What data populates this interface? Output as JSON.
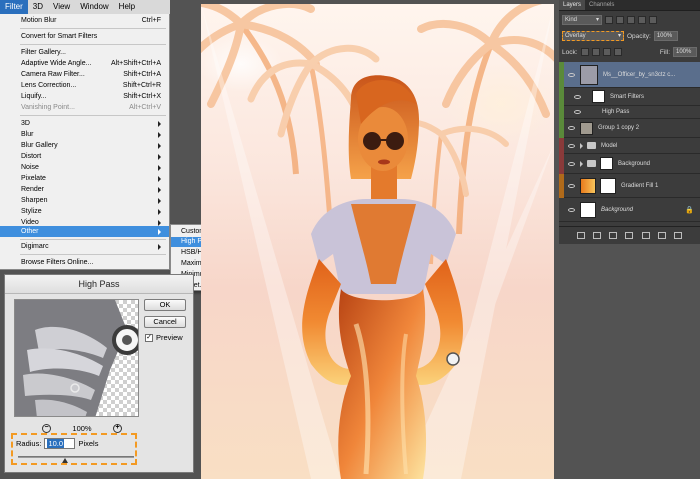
{
  "menubar": {
    "items": [
      "Filter",
      "3D",
      "View",
      "Window",
      "Help"
    ]
  },
  "filter_menu": {
    "last_filter": {
      "label": "Motion Blur",
      "shortcut": "Ctrl+F"
    },
    "convert": "Convert for Smart Filters",
    "group1": [
      {
        "label": "Filter Gallery...",
        "shortcut": ""
      },
      {
        "label": "Adaptive Wide Angle...",
        "shortcut": "Alt+Shift+Ctrl+A"
      },
      {
        "label": "Camera Raw Filter...",
        "shortcut": "Shift+Ctrl+A"
      },
      {
        "label": "Lens Correction...",
        "shortcut": "Shift+Ctrl+R"
      },
      {
        "label": "Liquify...",
        "shortcut": "Shift+Ctrl+X"
      },
      {
        "label": "Vanishing Point...",
        "shortcut": "Alt+Ctrl+V"
      }
    ],
    "submenus": [
      "3D",
      "Blur",
      "Blur Gallery",
      "Distort",
      "Noise",
      "Pixelate",
      "Render",
      "Sharpen",
      "Stylize",
      "Video",
      "Other"
    ],
    "digimarc": "Digimarc",
    "browse": "Browse Filters Online..."
  },
  "other_submenu": [
    "Custom...",
    "High Pass...",
    "HSB/HSL",
    "Maximum...",
    "Minimum...",
    "Offset..."
  ],
  "high_pass": {
    "title": "High Pass",
    "ok": "OK",
    "cancel": "Cancel",
    "preview_label": "Preview",
    "preview_checked": true,
    "zoom": "100%",
    "radius_label": "Radius:",
    "radius_value": "10.0",
    "unit": "Pixels"
  },
  "layers_panel": {
    "tabs": [
      "Layers",
      "Channels"
    ],
    "filter_kind": "Kind",
    "blend_mode": "Overlay",
    "opacity_label": "Opacity:",
    "opacity_value": "100%",
    "lock_label": "Lock:",
    "fill_label": "Fill:",
    "fill_value": "100%",
    "layers": [
      {
        "name": "Ms__Officer_by_sn3ctz c...",
        "color": "#5a8a3a"
      },
      {
        "name": "Smart Filters",
        "color": "#5a8a3a"
      },
      {
        "name": "High Pass",
        "color": "#5a8a3a"
      },
      {
        "name": "Group 1 copy 2",
        "color": "#5a8a3a"
      },
      {
        "name": "Model",
        "color": "#8a3a3a"
      },
      {
        "name": "Background",
        "color": "#8a3a3a"
      },
      {
        "name": "Gradient Fill 1",
        "color": "#b06a1a"
      },
      {
        "name": "Background",
        "color": ""
      }
    ]
  },
  "colors": {
    "accent": "#3f8fde",
    "highlight_dash": "#f39a23"
  }
}
